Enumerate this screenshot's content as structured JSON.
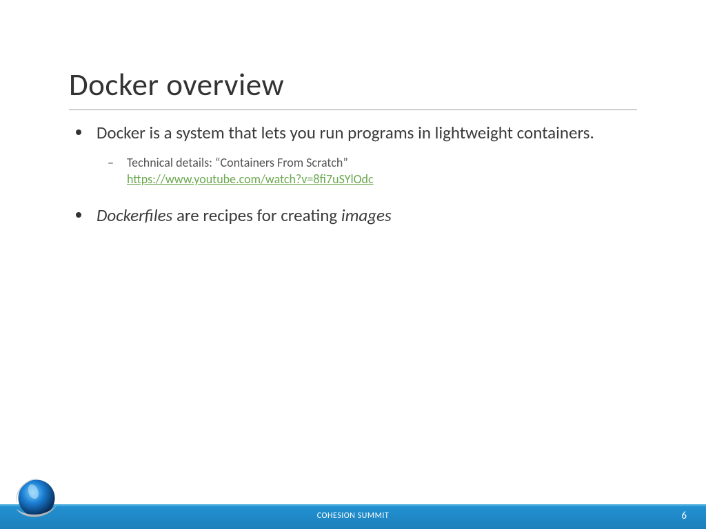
{
  "title": "Docker overview",
  "bullets": {
    "b1_text": "Docker is a system that lets you run programs in lightweight containers.",
    "b1_sub_label": "Technical details: “Containers From Scratch”",
    "b1_sub_link": "https://www.youtube.com/watch?v=8fi7uSYlOdc",
    "b2_pre": "Dockerfiles",
    "b2_mid": " are recipes for creating ",
    "b2_post": "images"
  },
  "footer": {
    "center": "COHESION SUMMIT",
    "page": "6"
  }
}
